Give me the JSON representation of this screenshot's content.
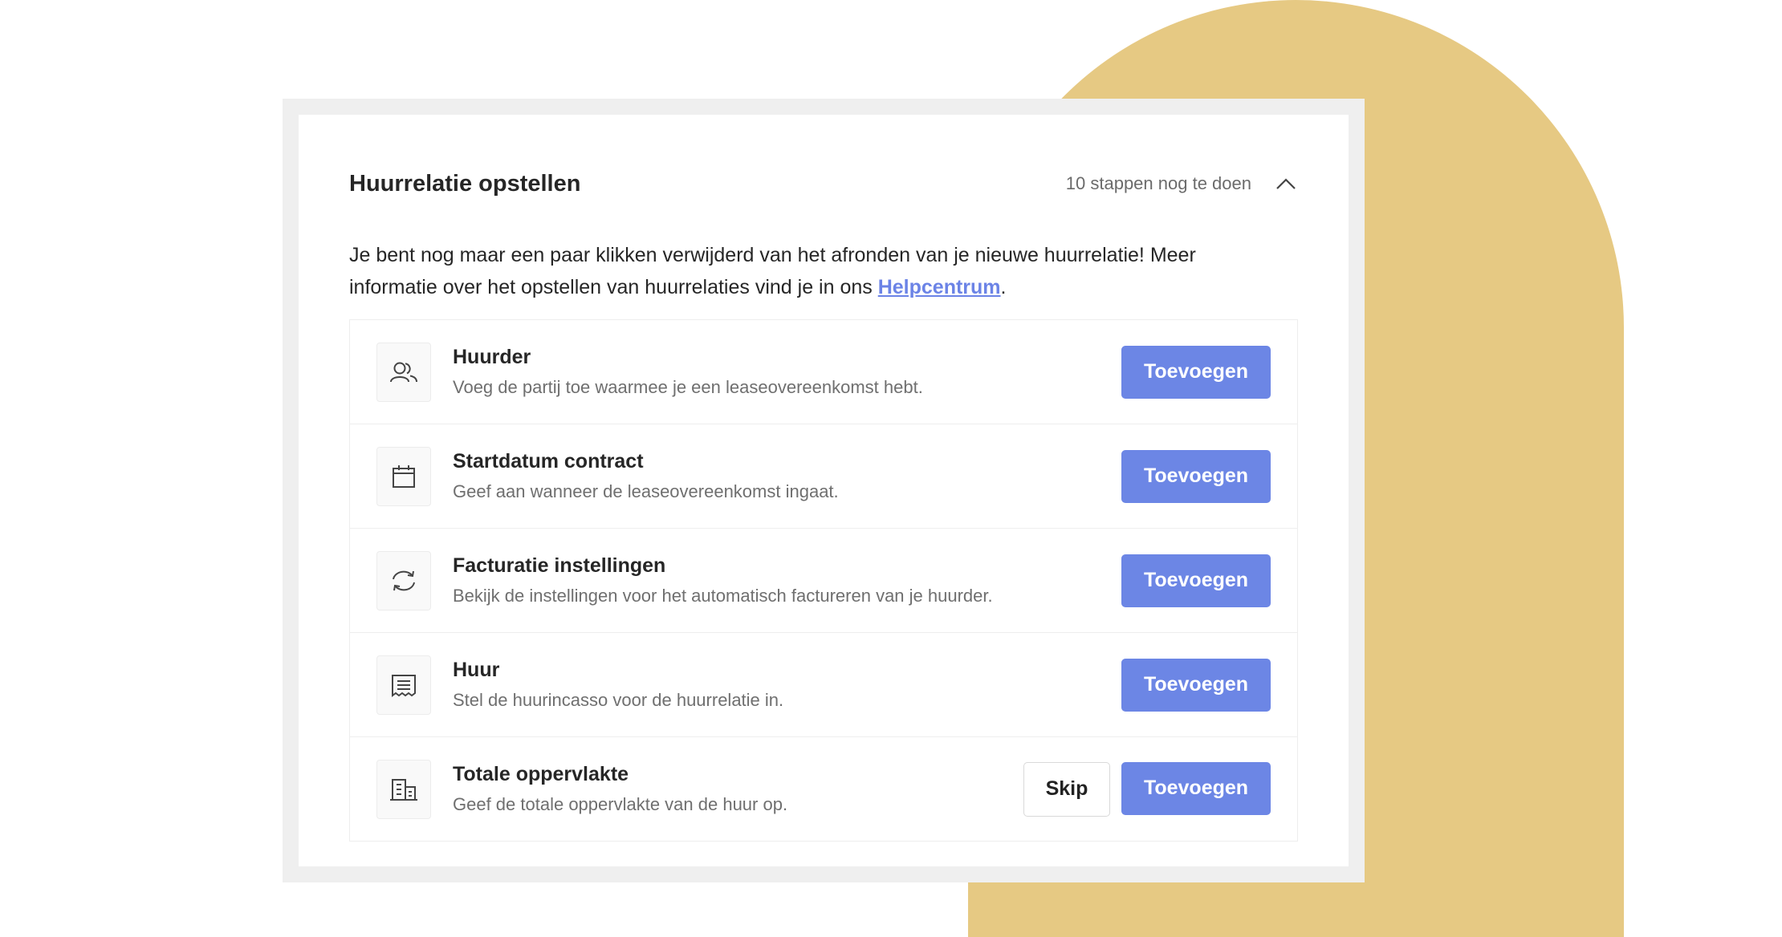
{
  "card": {
    "title": "Huurrelatie opstellen",
    "steps_remaining": "10 stappen nog te doen",
    "intro_text": "Je bent nog maar een paar klikken verwijderd van het afronden van je nieuwe huurrelatie! Meer informatie over het opstellen van huurrelaties vind je in ons ",
    "intro_link": "Helpcentrum",
    "intro_end": "."
  },
  "steps": [
    {
      "icon": "users-icon",
      "title": "Huurder",
      "description": "Voeg de partij toe waarmee je een leaseovereenkomst hebt.",
      "action": "Toevoegen"
    },
    {
      "icon": "calendar-icon",
      "title": "Startdatum contract",
      "description": "Geef aan wanneer de leaseovereenkomst ingaat.",
      "action": "Toevoegen"
    },
    {
      "icon": "refresh-icon",
      "title": "Facturatie instellingen",
      "description": "Bekijk de instellingen voor het automatisch factureren van je huurder.",
      "action": "Toevoegen"
    },
    {
      "icon": "receipt-icon",
      "title": "Huur",
      "description": "Stel de huurincasso voor de huurrelatie in.",
      "action": "Toevoegen"
    },
    {
      "icon": "building-icon",
      "title": "Totale oppervlakte",
      "description": "Geef de totale oppervlakte van de huur op.",
      "action": "Toevoegen",
      "secondary_action": "Skip"
    }
  ],
  "colors": {
    "accent": "#6c86e5",
    "decoration": "#e6c983",
    "link": "#6b83e6"
  }
}
